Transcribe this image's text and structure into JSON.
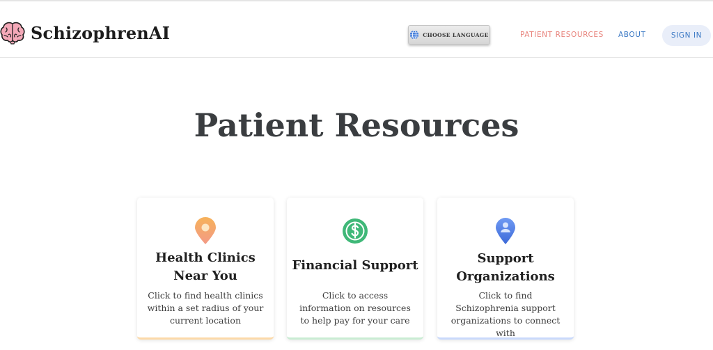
{
  "brand": {
    "name": "SchizophrenAI",
    "logo_icon": "brain-icon"
  },
  "nav": {
    "language_button_label": "CHOOSE LANGUAGE",
    "language_icon": "globe-icon",
    "links": [
      {
        "label": "PATIENT RESOURCES",
        "color": "#e8837c",
        "active": true
      },
      {
        "label": "ABOUT",
        "color": "#3a78c4",
        "active": false
      }
    ],
    "sign_in_label": "SIGN IN"
  },
  "page": {
    "title": "Patient Resources"
  },
  "cards": [
    {
      "icon": "map-pin-icon",
      "title": "Health Clinics Near You",
      "description": "Click to find health clinics within a set radius of your current location",
      "accent": "#fcd9a8"
    },
    {
      "icon": "dollar-icon",
      "title": "Financial Support",
      "description": "Click to access information on resources to help pay for your care",
      "accent": "#c9ecd3"
    },
    {
      "icon": "person-pin-icon",
      "title": "Support Organizations",
      "description": "Click to find Schizophrenia support organizations to connect with",
      "accent": "#c9d9fb"
    }
  ]
}
